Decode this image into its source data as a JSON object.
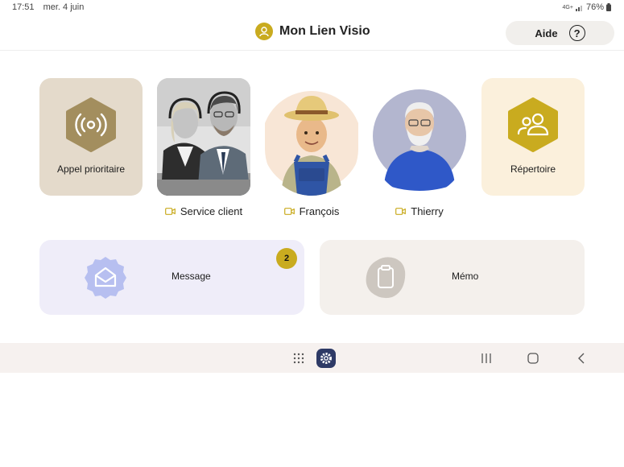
{
  "status_bar": {
    "time": "17:51",
    "date": "mer. 4 juin",
    "network": "4G+",
    "battery_percent": "76%"
  },
  "header": {
    "title": "Mon Lien Visio",
    "help_label": "Aide",
    "help_icon_glyph": "?"
  },
  "shortcuts": {
    "priority_label": "Appel prioritaire",
    "directory_label": "Répertoire"
  },
  "contacts": [
    {
      "name": "Service client",
      "icon": "video-icon",
      "avatar": "call-center-photo"
    },
    {
      "name": "François",
      "icon": "video-icon",
      "avatar": "farmer-avatar"
    },
    {
      "name": "Thierry",
      "icon": "video-icon",
      "avatar": "grandfather-avatar"
    }
  ],
  "cards": {
    "message_label": "Message",
    "message_badge": "2",
    "memo_label": "Mémo"
  },
  "colors": {
    "accent": "#c9ab1f",
    "priority_tile": "#e4dacb",
    "directory_tile": "#fbf0dc",
    "message_card": "#efedf9",
    "memo_card": "#f4f0ec",
    "message_icon": "#b7bff0",
    "memo_icon": "#cdc7c0"
  }
}
